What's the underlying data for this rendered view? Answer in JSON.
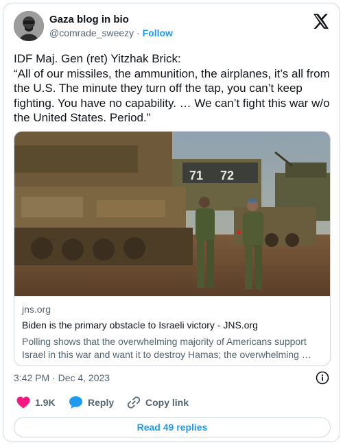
{
  "author": {
    "display_name": "Gaza blog in bio",
    "handle": "@comrade_sweezy",
    "separator": "·",
    "follow_label": "Follow",
    "avatar_icon": "profile-avatar"
  },
  "brand": {
    "logo_icon": "x-logo-icon"
  },
  "tweet": {
    "text": "IDF Maj. Gen (ret) Yitzhak Brick:\n“All of our missiles, the ammunition, the airplanes, it’s all from the U.S. The minute they turn off the tap, you can’t keep fighting. You have no capability. … We can’t fight this war w/o the United States. Period.”",
    "timestamp": "3:42 PM · Dec 4, 2023"
  },
  "link_card": {
    "image_icon": "photo-tanks-soldiers",
    "domain": "jns.org",
    "title": "Biden is the primary obstacle to Israeli victory - JNS.org",
    "description": "Polling shows that the overwhelming majority of Americans support Israel in this war and want it to destroy Hamas; the overwhelming …"
  },
  "actions": {
    "like_count": "1.9K",
    "reply_label": "Reply",
    "copy_link_label": "Copy link",
    "read_replies_label": "Read 49 replies"
  },
  "colors": {
    "accent": "#1d9bf0",
    "like": "#f91880",
    "text_primary": "#0f1419",
    "text_secondary": "#536471",
    "border": "#cfd9de"
  }
}
